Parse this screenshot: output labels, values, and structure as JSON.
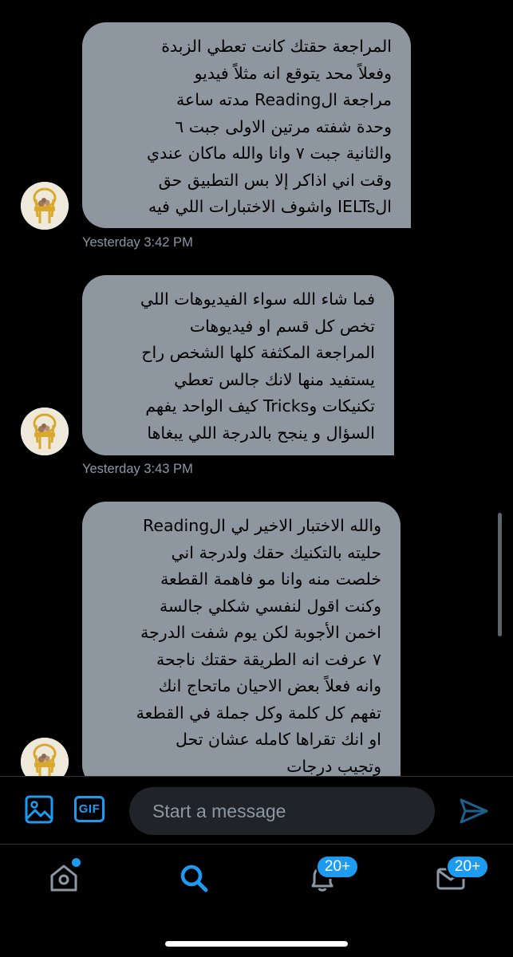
{
  "conversation": {
    "messages": [
      {
        "lines": [
          "المراجعة حقتك كانت تعطي الزبدة",
          "وفعلاً محد يتوقع انه مثلاً فيديو",
          "مراجعة الReading مدته ساعة",
          "وحدة شفته مرتين الاولى جبت ٦",
          "والثانية جبت ٧ وانا والله ماكان عندي",
          "وقت اني اذاكر إلا بس التطبيق حق",
          "الIELTs واشوف الاختبارات اللي فيه"
        ],
        "timestamp": "Yesterday 3:42 PM"
      },
      {
        "lines": [
          "فما شاء الله سواء الفيديوهات اللي",
          "تخص كل قسم او فيديوهات",
          "المراجعة المكثفة كلها الشخص راح",
          "يستفيد منها لانك جالس تعطي",
          "تكنيكات وTricks كيف الواحد يفهم",
          "السؤال و ينجح بالدرجة اللي يبغاها"
        ],
        "timestamp": "Yesterday 3:43 PM"
      },
      {
        "lines": [
          "والله الاختبار الاخير لي الReading",
          "حليته بالتكنيك حقك ولدرجة اني",
          "خلصت منه وانا مو فاهمة القطعة",
          "وكنت اقول لنفسي شكلي جالسة",
          "اخمن الأجوبة لكن يوم شفت الدرجة",
          "٧ عرفت انه الطريقة حقتك ناجحة",
          "وانه فعلاً بعض الاحيان ماتحاج انك",
          "تفهم كل كلمة وكل جملة في القطعة",
          "او انك تقراها كامله عشان تحل",
          "وتجيب درجات"
        ]
      }
    ]
  },
  "composer": {
    "image_icon": "image-icon",
    "gif_label": "GIF",
    "placeholder": "Start a message",
    "send_icon": "send-icon"
  },
  "tabbar": {
    "home_icon": "home-icon",
    "search_icon": "search-icon",
    "notifications_icon": "bell-icon",
    "messages_icon": "envelope-icon",
    "notifications_badge": "20+",
    "messages_badge": "20+"
  },
  "colors": {
    "background": "#000000",
    "bubble": "#8e979f",
    "accent": "#1d9bf0",
    "timestamp": "#8b98a5",
    "input_background": "#202327"
  }
}
